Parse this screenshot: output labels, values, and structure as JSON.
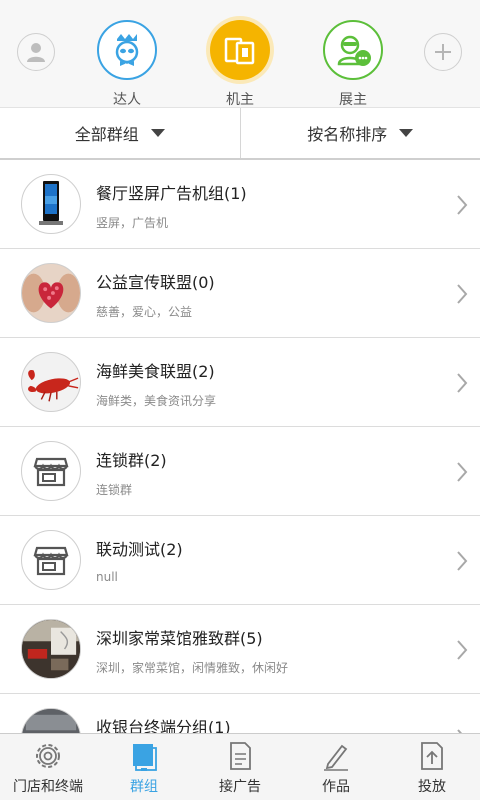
{
  "top_roles": [
    {
      "label": "达人",
      "icon": "expert-face-icon",
      "color": "#3aa3e3"
    },
    {
      "label": "机主",
      "icon": "device-owner-icon",
      "color": "#f5b400"
    },
    {
      "label": "展主",
      "icon": "exhibitor-chat-icon",
      "color": "#5cbf3a"
    }
  ],
  "top_left_icon": "user-icon",
  "top_right_icon": "add-icon",
  "filters": {
    "group_filter": "全部群组",
    "sort_filter": "按名称排序"
  },
  "groups": [
    {
      "title": "餐厅竖屏广告机组(1)",
      "subtitle": "竖屏，广告机",
      "avatar": "ad-kiosk-image"
    },
    {
      "title": "公益宣传联盟(0)",
      "subtitle": "慈善，爱心，公益",
      "avatar": "heart-hands-image"
    },
    {
      "title": "海鲜美食联盟(2)",
      "subtitle": "海鲜类，美食资讯分享",
      "avatar": "lobster-image"
    },
    {
      "title": "连锁群(2)",
      "subtitle": "连锁群",
      "avatar": "store-icon"
    },
    {
      "title": "联动测试(2)",
      "subtitle": "null",
      "avatar": "store-icon"
    },
    {
      "title": "深圳家常菜馆雅致群(5)",
      "subtitle": "深圳，家常菜馆，闲情雅致，休闲好",
      "avatar": "desk-photo-image"
    },
    {
      "title": "收银台终端分组(1)",
      "subtitle": "",
      "avatar": "cashier-image"
    }
  ],
  "tabs": [
    {
      "label": "门店和终端",
      "icon": "gear-icon"
    },
    {
      "label": "群组",
      "icon": "group-screen-icon",
      "active": true
    },
    {
      "label": "接广告",
      "icon": "document-icon"
    },
    {
      "label": "作品",
      "icon": "pen-icon"
    },
    {
      "label": "投放",
      "icon": "upload-file-icon"
    }
  ],
  "colors": {
    "accent_blue": "#3aa3e3",
    "accent_yellow": "#f5b400",
    "accent_green": "#5cbf3a"
  }
}
